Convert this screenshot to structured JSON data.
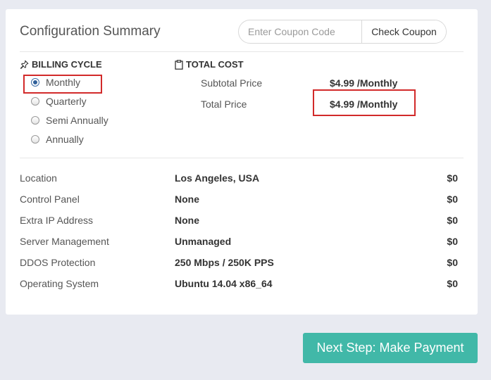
{
  "summary": {
    "title": "Configuration Summary",
    "coupon_placeholder": "Enter Coupon Code",
    "coupon_button": "Check Coupon"
  },
  "billing": {
    "heading": "BILLING CYCLE",
    "options": [
      "Monthly",
      "Quarterly",
      "Semi Annually",
      "Annually"
    ],
    "selected": "Monthly"
  },
  "total": {
    "heading": "TOTAL COST",
    "subtotal_label": "Subtotal Price",
    "subtotal_value": "$4.99 /Monthly",
    "total_label": "Total Price",
    "total_value": "$4.99 /Monthly"
  },
  "specs": [
    {
      "label": "Location",
      "value": "Los Angeles, USA",
      "price": "$0"
    },
    {
      "label": "Control Panel",
      "value": "None",
      "price": "$0"
    },
    {
      "label": "Extra IP Address",
      "value": "None",
      "price": "$0"
    },
    {
      "label": "Server Management",
      "value": "Unmanaged",
      "price": "$0"
    },
    {
      "label": "DDOS Protection",
      "value": "250 Mbps / 250K PPS",
      "price": "$0"
    },
    {
      "label": "Operating System",
      "value": "Ubuntu 14.04 x86_64",
      "price": "$0"
    }
  ],
  "next_button": "Next Step: Make Payment",
  "colors": {
    "accent": "#41b8a8",
    "highlight": "#d22a2a",
    "radio_checked": "#2f5f99"
  }
}
